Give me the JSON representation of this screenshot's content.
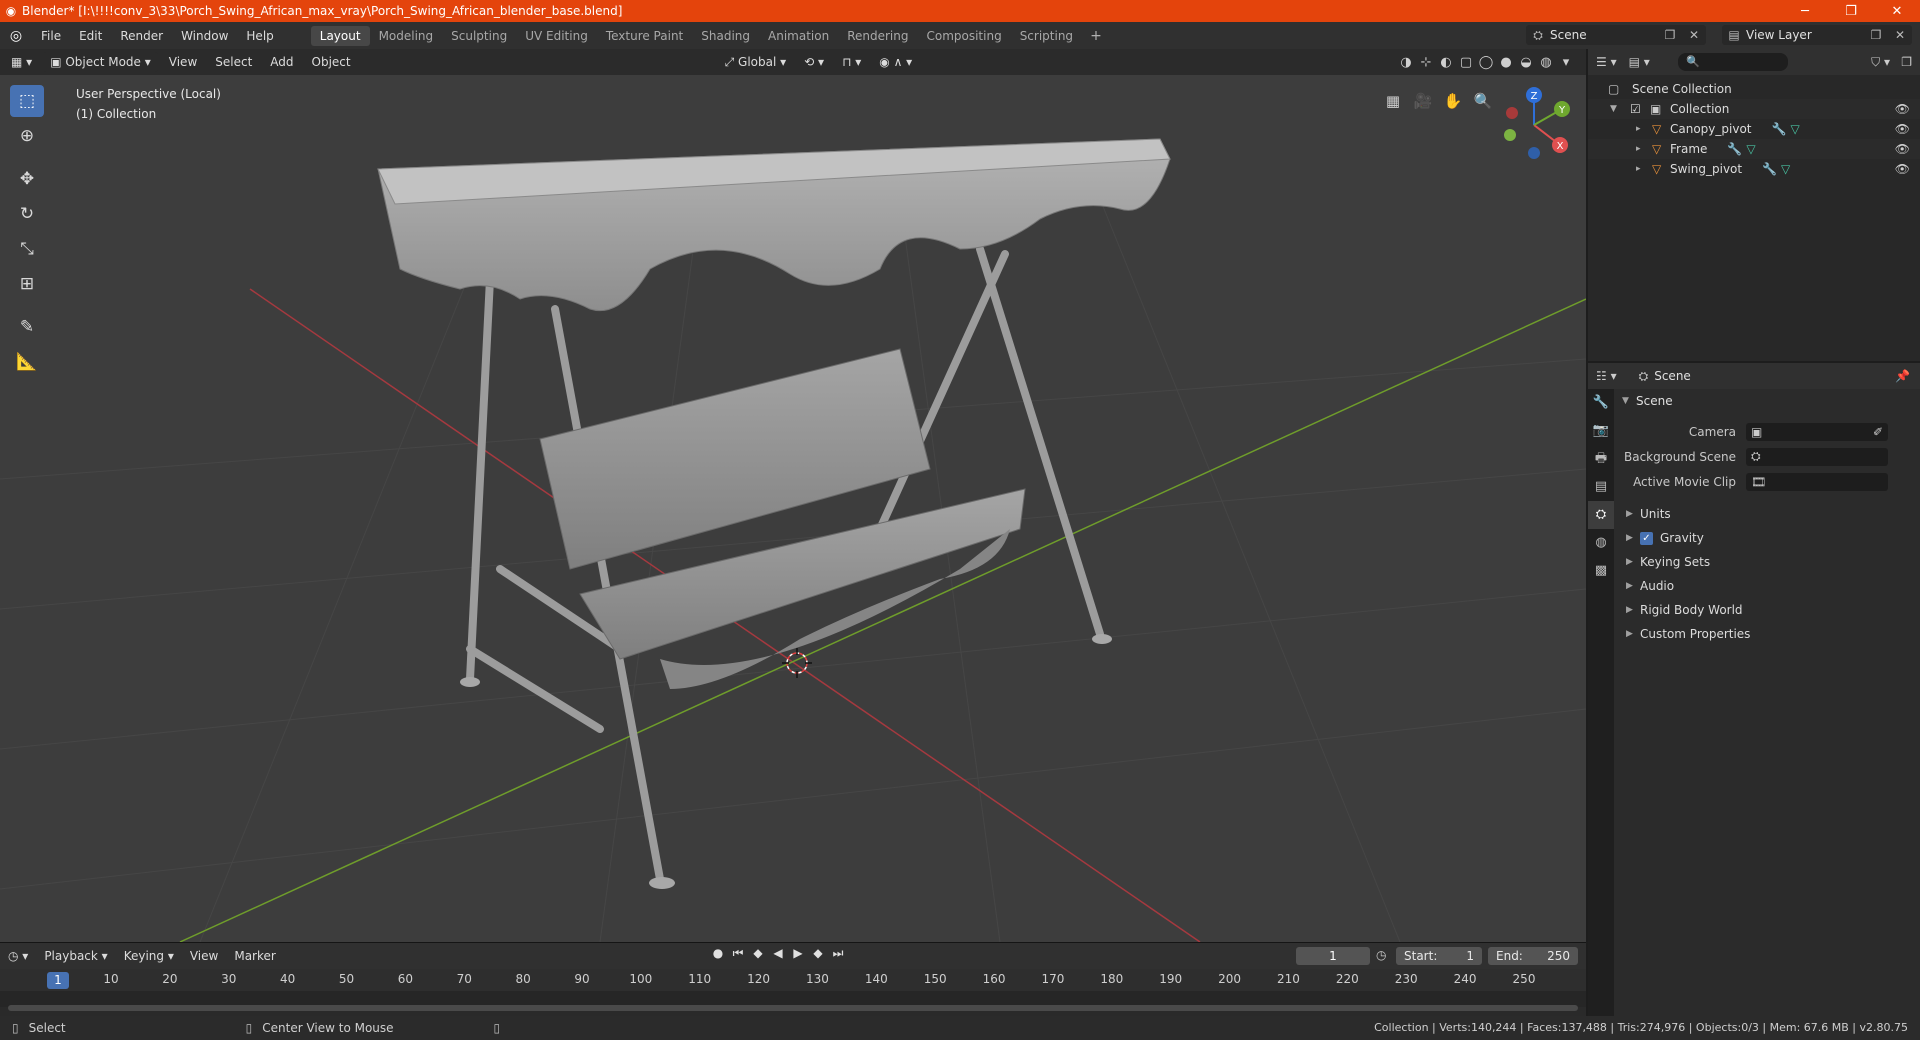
{
  "window": {
    "title": "Blender* [I:\\!!!!conv_3\\33\\Porch_Swing_African_max_vray\\Porch_Swing_African_blender_base.blend]",
    "minimize": "─",
    "maximize": "❐",
    "close": "✕"
  },
  "menubar": {
    "items": [
      "File",
      "Edit",
      "Render",
      "Window",
      "Help"
    ],
    "workspaces": [
      "Layout",
      "Modeling",
      "Sculpting",
      "UV Editing",
      "Texture Paint",
      "Shading",
      "Animation",
      "Rendering",
      "Compositing",
      "Scripting"
    ],
    "active_workspace": "Layout",
    "add": "+",
    "scene": "Scene",
    "view_layer": "View Layer"
  },
  "viewport": {
    "mode": "Object Mode",
    "menus": [
      "View",
      "Select",
      "Add",
      "Object"
    ],
    "orientation": "Global",
    "info_line1": "User Perspective (Local)",
    "info_line2": "(1) Collection",
    "gizmo": {
      "x": "X",
      "y": "Y",
      "z": "Z"
    },
    "colors": {
      "x_axis": "#a5393f",
      "y_axis": "#6f9d2b",
      "bg": "#3d3d3d"
    }
  },
  "timeline": {
    "menus": [
      "Playback",
      "Keying",
      "View",
      "Marker"
    ],
    "current_frame": "1",
    "start_label": "Start:",
    "start": "1",
    "end_label": "End:",
    "end": "250",
    "ticks": [
      "1",
      "10",
      "20",
      "30",
      "40",
      "50",
      "60",
      "70",
      "80",
      "90",
      "100",
      "110",
      "120",
      "130",
      "140",
      "150",
      "160",
      "170",
      "180",
      "190",
      "200",
      "210",
      "220",
      "230",
      "240",
      "250"
    ]
  },
  "outliner": {
    "root": "Scene Collection",
    "collection": "Collection",
    "objects": [
      "Canopy_pivot",
      "Frame",
      "Swing_pivot"
    ]
  },
  "properties": {
    "header": "Scene",
    "section": "Scene",
    "fields": [
      {
        "label": "Camera"
      },
      {
        "label": "Background Scene"
      },
      {
        "label": "Active Movie Clip"
      }
    ],
    "subpanels": [
      "Units",
      "Gravity",
      "Keying Sets",
      "Audio",
      "Rigid Body World",
      "Custom Properties"
    ]
  },
  "statusbar": {
    "left": "Select",
    "middle": "Center View to Mouse",
    "right": "Collection | Verts:140,244 | Faces:137,488 | Tris:274,976 | Objects:0/3 | Mem: 67.6 MB | v2.80.75"
  }
}
